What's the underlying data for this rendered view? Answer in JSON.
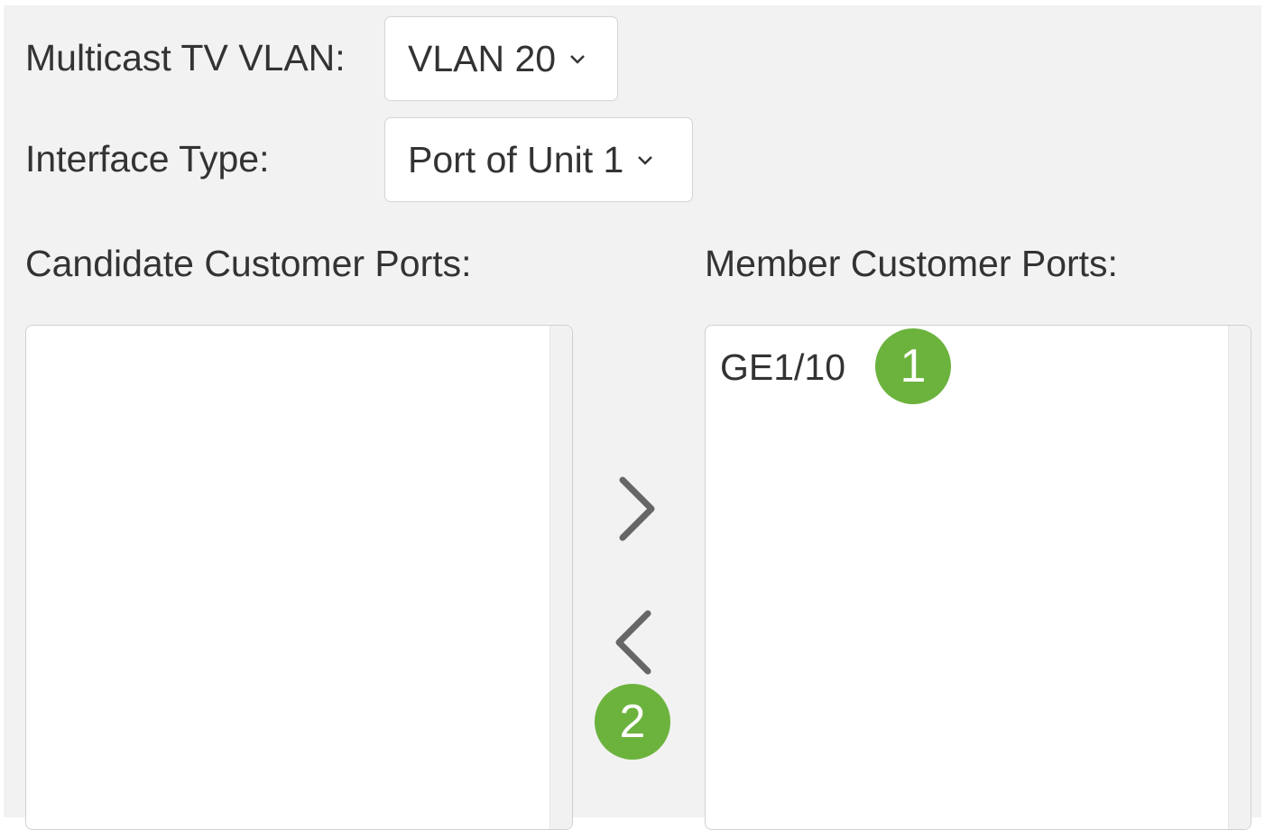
{
  "form": {
    "multicast_tv_vlan": {
      "label": "Multicast TV VLAN:",
      "selected": "VLAN 20"
    },
    "interface_type": {
      "label": "Interface Type:",
      "selected": "Port of Unit 1"
    },
    "candidate_ports": {
      "label": "Candidate Customer Ports:",
      "items": []
    },
    "member_ports": {
      "label": "Member Customer Ports:",
      "items": [
        "GE1/10"
      ]
    }
  },
  "transfer": {
    "add_icon": "chevron-right-icon",
    "remove_icon": "chevron-left-icon"
  },
  "callouts": {
    "one": "1",
    "two": "2"
  },
  "colors": {
    "panel_bg": "#f2f2f2",
    "badge_green": "#6cb33e",
    "arrow_gray": "#666666",
    "text": "#333333"
  }
}
